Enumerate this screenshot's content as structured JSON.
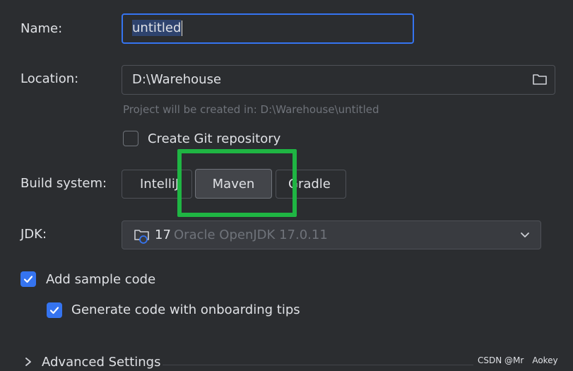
{
  "form": {
    "name_label": "Name:",
    "name_value": "untitled",
    "location_label": "Location:",
    "location_value": "D:\\Warehouse",
    "location_hint": "Project will be created in: D:\\Warehouse\\untitled",
    "git_label": "Create Git repository",
    "git_checked": false,
    "build_system_label": "Build system:",
    "build_options": [
      "IntelliJ",
      "Maven",
      "Gradle"
    ],
    "build_selected": "Maven",
    "jdk_label": "JDK:",
    "jdk_version": "17",
    "jdk_name": "Oracle OpenJDK 17.0.11",
    "sample_code_label": "Add sample code",
    "sample_code_checked": true,
    "onboarding_label": "Generate code with onboarding tips",
    "onboarding_checked": true,
    "advanced_label": "Advanced Settings"
  },
  "colors": {
    "background": "#2b2d30",
    "accent": "#3574f0",
    "annotation_green": "#1fb543"
  },
  "icons": {
    "folder": "folder-icon",
    "jdk": "jdk-folder-icon",
    "dropdown": "chevron-down-icon",
    "expand": "chevron-right-icon",
    "check": "check-icon"
  },
  "watermark": "CSDN @Mr　Aokey"
}
